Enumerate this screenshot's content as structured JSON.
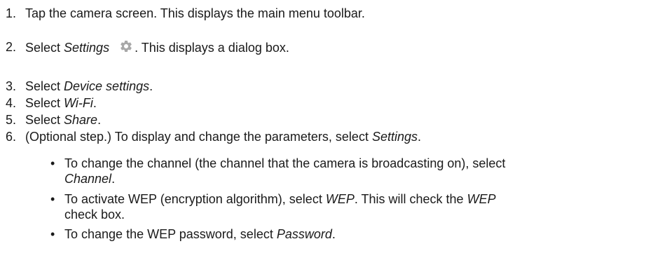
{
  "steps": [
    {
      "num": "1.",
      "text": "Tap the camera screen. This displays the main menu toolbar."
    },
    {
      "num": "2.",
      "pre": "Select ",
      "em": "Settings",
      "post": ". This displays a dialog box.",
      "icon": "gear-icon"
    },
    {
      "num": "3.",
      "pre": "Select ",
      "em": "Device settings",
      "post": "."
    },
    {
      "num": "4.",
      "pre": "Select ",
      "em": "Wi-Fi",
      "post": "."
    },
    {
      "num": "5.",
      "pre": "Select ",
      "em": "Share",
      "post": "."
    },
    {
      "num": "6.",
      "pre": "(Optional step.) To display and change the parameters, select ",
      "em": "Settings",
      "post": "."
    }
  ],
  "bullets": [
    {
      "line1": "To change the channel (the channel that the camera is broadcasting on), select",
      "em2": "Channel",
      "post2": "."
    },
    {
      "pre1": "To activate WEP (encryption algorithm), select ",
      "em1": "WEP",
      "mid1": ". This will check the ",
      "em1b": "WEP",
      "line2": "check box."
    },
    {
      "pre1": "To change the WEP password, select ",
      "em1": "Password",
      "post1": "."
    }
  ],
  "colors": {
    "text": "#1a1a1a",
    "icon": "#a8a8a8"
  }
}
